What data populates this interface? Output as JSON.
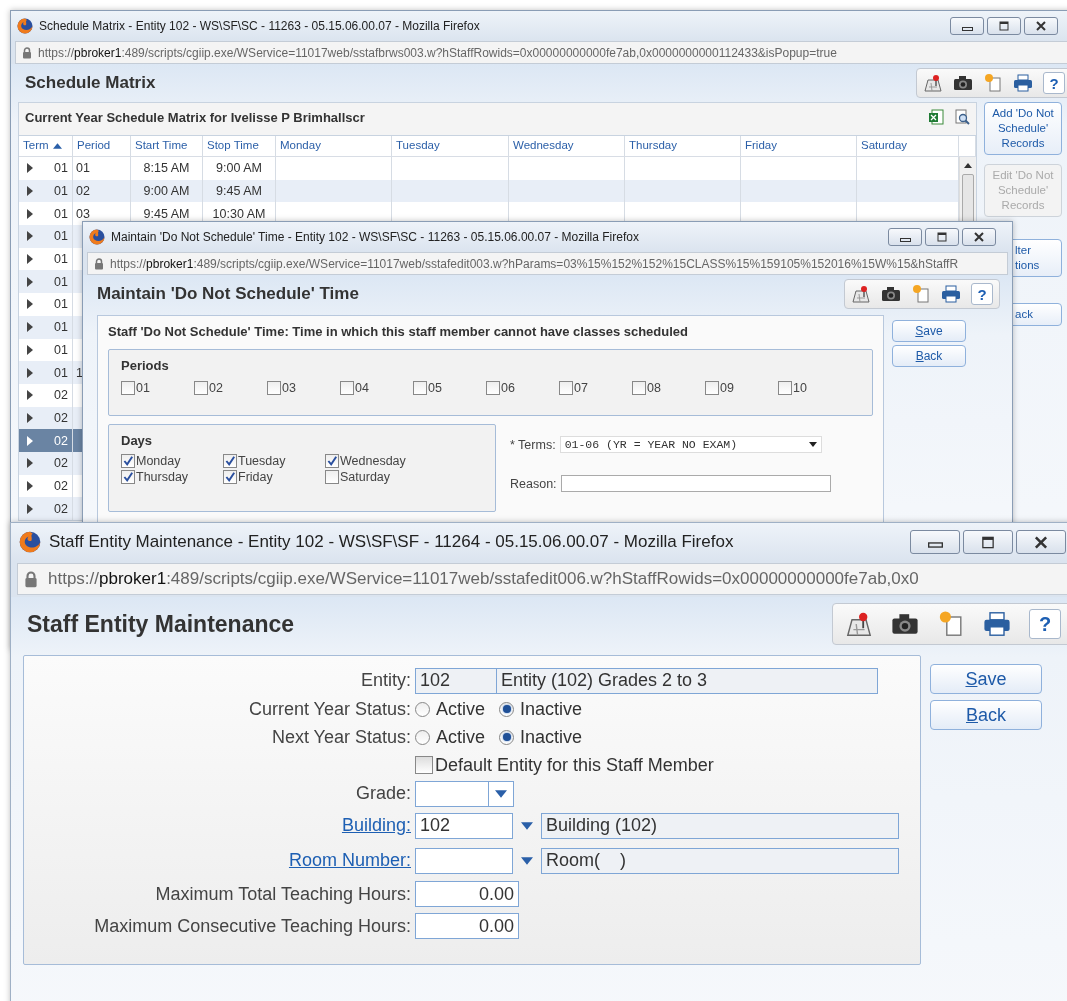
{
  "schedule_window": {
    "title": "Schedule Matrix - Entity 102 - WS\\SF\\SC - 11263 - 05.15.06.00.07 - Mozilla Firefox",
    "url": "https://**pbroker1**:489/scripts/cgiip.exe/WService=11017web/sstafbrws003.w?hStaffRowids=0x00000000000fe7ab,0x0000000000112433&isPopup=true",
    "page_title": "Schedule Matrix",
    "help": "?",
    "grid": {
      "title": "Current Year Schedule Matrix for Ivelisse P Brimhallscr",
      "columns": [
        {
          "label": "Term",
          "sorted": true
        },
        {
          "label": "Period",
          "sorted": false
        },
        {
          "label": "Start Time",
          "sorted": false
        },
        {
          "label": "Stop Time",
          "sorted": false
        },
        {
          "label": "Monday",
          "sorted": false
        },
        {
          "label": "Tuesday",
          "sorted": false
        },
        {
          "label": "Wednesday",
          "sorted": false
        },
        {
          "label": "Thursday",
          "sorted": false
        },
        {
          "label": "Friday",
          "sorted": false
        },
        {
          "label": "Saturday",
          "sorted": false
        }
      ],
      "rows": [
        {
          "term": "01",
          "period": "01",
          "start_time": "8:15 AM",
          "stop_time": "9:00 AM",
          "selected": false
        },
        {
          "term": "01",
          "period": "02",
          "start_time": "9:00 AM",
          "stop_time": "9:45 AM",
          "selected": false
        },
        {
          "term": "01",
          "period": "03",
          "start_time": "9:45 AM",
          "stop_time": "10:30 AM",
          "selected": false
        },
        {
          "term": "01",
          "selected": false
        },
        {
          "term": "01",
          "selected": false
        },
        {
          "term": "01",
          "selected": false
        },
        {
          "term": "01",
          "selected": false
        },
        {
          "term": "01",
          "selected": false
        },
        {
          "term": "01",
          "selected": false
        },
        {
          "term": "01",
          "period": "1",
          "selected": false
        },
        {
          "term": "02",
          "selected": false
        },
        {
          "term": "02",
          "selected": false
        },
        {
          "term": "02",
          "selected": true
        },
        {
          "term": "02",
          "selected": false
        },
        {
          "term": "02",
          "selected": false
        },
        {
          "term": "02",
          "selected": false
        }
      ]
    },
    "side_buttons": [
      {
        "label": "Add 'Do Not Schedule' Records",
        "disabled": false
      },
      {
        "label": "Edit 'Do Not Schedule' Records",
        "disabled": true
      },
      {
        "label": "lter tions",
        "disabled": false
      },
      {
        "label": "ack",
        "disabled": false
      }
    ]
  },
  "dns_window": {
    "title": "Maintain 'Do Not Schedule' Time - Entity 102 - WS\\SF\\SC - 11263 - 05.15.06.00.07 - Mozilla Firefox",
    "url": "https://**pbroker1**:489/scripts/cgiip.exe/WService=11017web/sstafedit003.w?hParams=03%15%152%152%15CLASS%15%159105%152016%15W%15&hStaffR",
    "page_title": "Maintain 'Do Not Schedule' Time",
    "help": "?",
    "heading": "Staff 'Do Not Schedule' Time: Time in which this staff member cannot have classes scheduled",
    "periods": {
      "title": "Periods",
      "items": [
        {
          "label": "01",
          "checked": false
        },
        {
          "label": "02",
          "checked": false
        },
        {
          "label": "03",
          "checked": false
        },
        {
          "label": "04",
          "checked": false
        },
        {
          "label": "05",
          "checked": false
        },
        {
          "label": "06",
          "checked": false
        },
        {
          "label": "07",
          "checked": false
        },
        {
          "label": "08",
          "checked": false
        },
        {
          "label": "09",
          "checked": false
        },
        {
          "label": "10",
          "checked": false
        }
      ]
    },
    "days": {
      "title": "Days",
      "items": [
        {
          "label": "Monday",
          "checked": true
        },
        {
          "label": "Tuesday",
          "checked": true
        },
        {
          "label": "Wednesday",
          "checked": true
        },
        {
          "label": "Thursday",
          "checked": true
        },
        {
          "label": "Friday",
          "checked": true
        },
        {
          "label": "Saturday",
          "checked": false
        }
      ]
    },
    "terms": {
      "label": "* Terms:",
      "value": "01-06 (YR = YEAR NO EXAM)"
    },
    "reason": {
      "label": "Reason:"
    },
    "buttons": [
      {
        "label": "Save"
      },
      {
        "label": "Back"
      }
    ]
  },
  "entity_window": {
    "title": "Staff Entity Maintenance - Entity 102 - WS\\SF\\SF - 11264 - 05.15.06.00.07 - Mozilla Firefox",
    "url": "https://**pbroker1**:489/scripts/cgiip.exe/WService=11017web/sstafedit006.w?hStaffRowids=0x00000000000fe7ab,0x0",
    "page_title": "Staff Entity Maintenance",
    "help": "?",
    "fields": [
      {
        "kind": "code_desc",
        "label": "Entity:",
        "code": "102",
        "description": "Entity (102) Grades 2 to 3"
      },
      {
        "kind": "radio",
        "label": "Current Year Status:",
        "options": [
          {
            "label": "Active",
            "selected": false
          },
          {
            "label": "Inactive",
            "selected": true
          }
        ]
      },
      {
        "kind": "radio",
        "label": "Next Year Status:",
        "options": [
          {
            "label": "Active",
            "selected": false
          },
          {
            "label": "Inactive",
            "selected": true
          }
        ]
      },
      {
        "kind": "checkbox",
        "label": "Default Entity for this Staff Member",
        "checked": false
      },
      {
        "kind": "select",
        "label": "Grade:"
      },
      {
        "kind": "lookup",
        "label": "Building:",
        "link": true,
        "value": "102",
        "description": "Building (102)"
      },
      {
        "kind": "lookup",
        "label": "Room Number:",
        "link": true,
        "description": "Room(    )"
      },
      {
        "kind": "number",
        "label": "Maximum Total Teaching Hours:",
        "value": "0.00"
      },
      {
        "kind": "number",
        "label": "Maximum Consecutive Teaching Hours:",
        "value": "0.00"
      }
    ],
    "buttons": [
      {
        "label": "Save"
      },
      {
        "label": "Back"
      }
    ]
  }
}
